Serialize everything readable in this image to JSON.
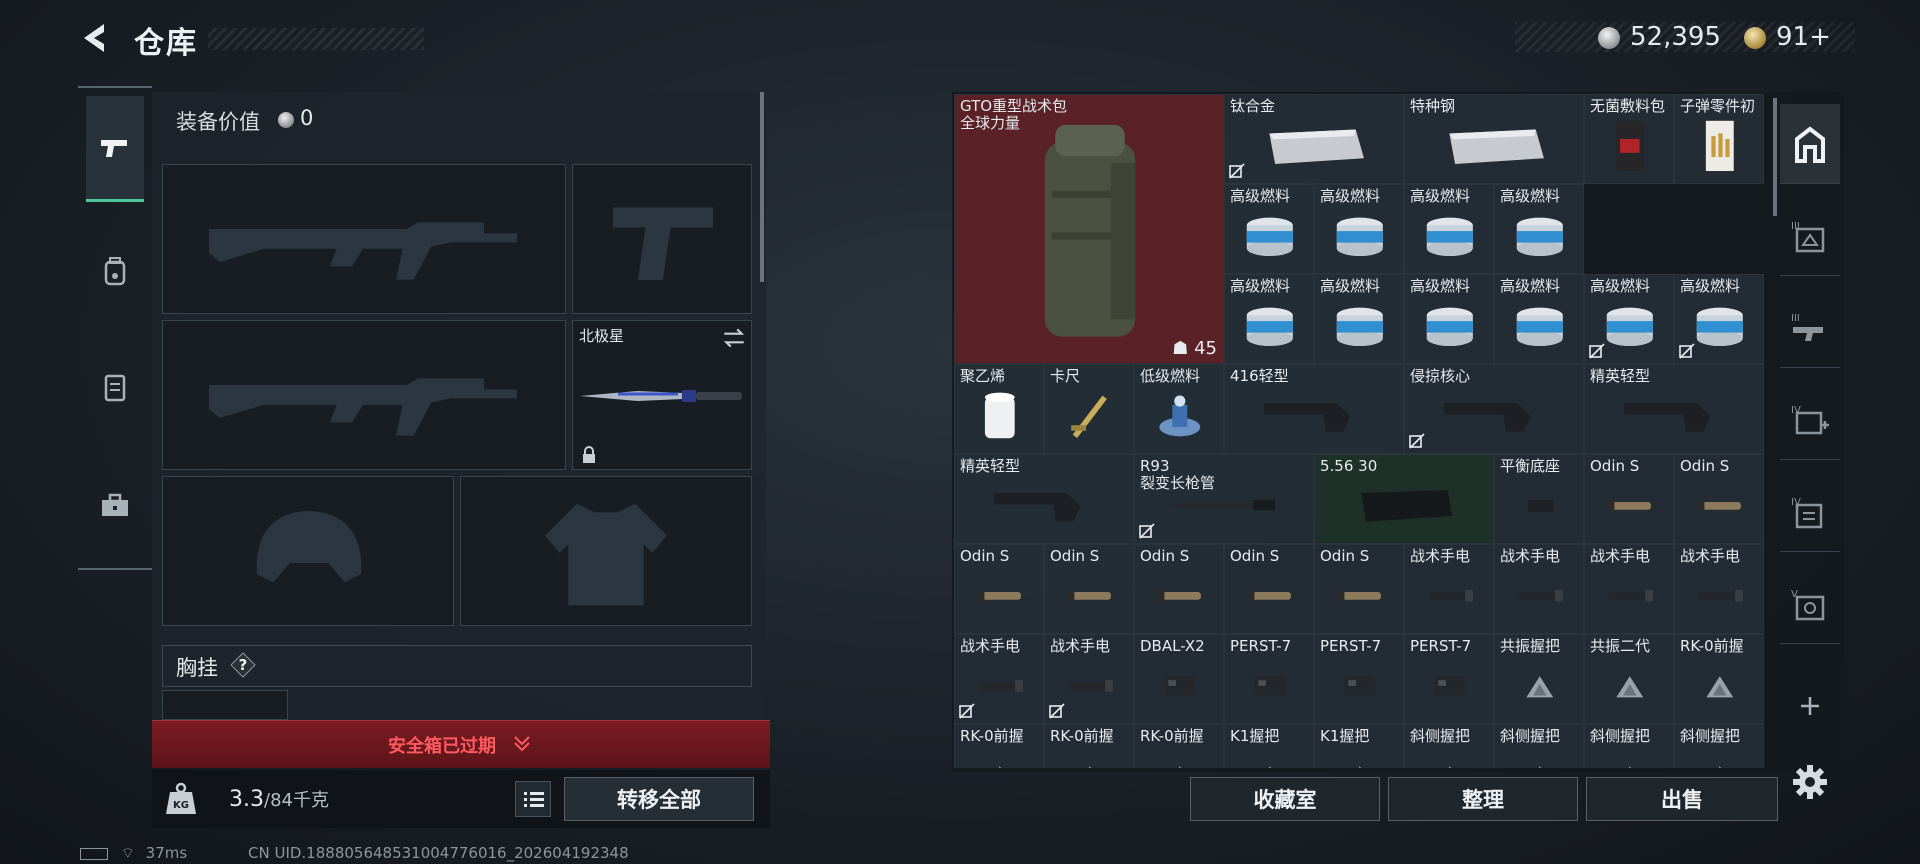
{
  "header": {
    "title": "仓库",
    "money": "52,395",
    "tokens": "91+"
  },
  "left_rail": {
    "tabs": [
      {
        "icon": "pistol-icon",
        "active": true
      },
      {
        "icon": "backpack-icon",
        "active": false
      },
      {
        "icon": "clipboard-icon",
        "active": false
      },
      {
        "icon": "toolbox-icon",
        "active": false
      }
    ]
  },
  "loadout": {
    "equip_value_label": "装备价值",
    "equip_value": "0",
    "melee_name": "北极星",
    "chest_label": "胸挂",
    "chest_help": "?",
    "safebox_text": "安全箱已过期",
    "weight_value": "3.3",
    "weight_max": "/84千克",
    "transfer_all": "转移全部"
  },
  "warehouse": {
    "items": [
      {
        "label": "GTO重型战术包\n全球力量",
        "count": "45",
        "bg": "#5a2227"
      },
      {
        "label": "钛合金",
        "noinsure": true
      },
      {
        "label": "特种钢"
      },
      {
        "label": "无菌敷料包"
      },
      {
        "label": "子弹零件初"
      },
      {
        "label": "高级燃料"
      },
      {
        "label": "高级燃料"
      },
      {
        "label": "高级燃料"
      },
      {
        "label": "高级燃料"
      },
      {
        "label": "高级燃料"
      },
      {
        "label": "高级燃料"
      },
      {
        "label": "高级燃料"
      },
      {
        "label": "高级燃料"
      },
      {
        "label": "高级燃料",
        "noinsure": true
      },
      {
        "label": "高级燃料",
        "noinsure": true
      },
      {
        "label": "聚乙烯"
      },
      {
        "label": "卡尺"
      },
      {
        "label": "低级燃料"
      },
      {
        "label": "416轻型"
      },
      {
        "label": "侵掠核心",
        "noinsure": true
      },
      {
        "label": "精英轻型"
      },
      {
        "label": "精英轻型"
      },
      {
        "label": "R93\n裂变长枪管",
        "noinsure": true
      },
      {
        "label": "5.56 30",
        "bg": "#1e3128"
      },
      {
        "label": "平衡底座"
      },
      {
        "label": "Odin S"
      },
      {
        "label": "Odin S"
      },
      {
        "label": "Odin S"
      },
      {
        "label": "Odin S"
      },
      {
        "label": "Odin S"
      },
      {
        "label": "Odin S"
      },
      {
        "label": "Odin S"
      },
      {
        "label": "战术手电"
      },
      {
        "label": "战术手电"
      },
      {
        "label": "战术手电"
      },
      {
        "label": "战术手电"
      },
      {
        "label": "战术手电",
        "noinsure": true
      },
      {
        "label": "战术手电",
        "noinsure": true
      },
      {
        "label": "DBAL-X2"
      },
      {
        "label": "PERST-7"
      },
      {
        "label": "PERST-7"
      },
      {
        "label": "PERST-7"
      },
      {
        "label": "共振握把"
      },
      {
        "label": "共振二代"
      },
      {
        "label": "RK-0前握"
      },
      {
        "label": "RK-0前握"
      },
      {
        "label": "RK-0前握"
      },
      {
        "label": "RK-0前握"
      },
      {
        "label": "K1握把"
      },
      {
        "label": "K1握把"
      },
      {
        "label": "斜侧握把"
      },
      {
        "label": "斜侧握把"
      },
      {
        "label": "斜侧握把"
      },
      {
        "label": "斜侧握把"
      }
    ],
    "buttons": {
      "collection": "收藏室",
      "sort": "整理",
      "sell": "出售"
    }
  },
  "right_rail": {
    "tabs": [
      "home-icon",
      "tier3-crate-icon",
      "tier3-rifle-icon",
      "tier4-medkit-icon",
      "tier4-docs-icon",
      "tier5-safe-icon",
      "add-icon"
    ]
  },
  "status": {
    "ping": "37ms",
    "uid": "CN UID.188805648531004776016_202604192348"
  },
  "colors": {
    "accent_green": "#4fc59a",
    "alert_red": "#ff5a5f",
    "rare_red_bg": "#5a2227"
  }
}
